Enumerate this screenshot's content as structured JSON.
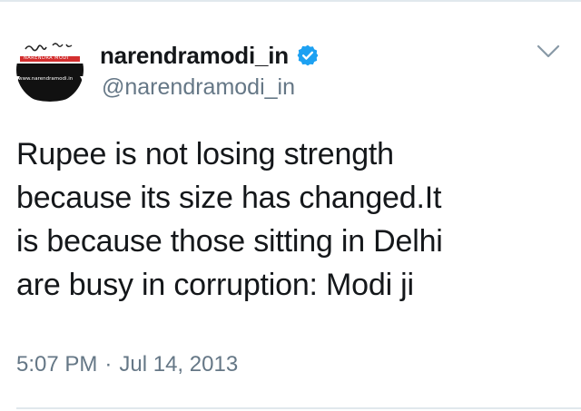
{
  "tweet": {
    "display_name": "narendramodi_in",
    "handle": "@narendramodi_in",
    "verified": true,
    "text": "Rupee is not losing strength\nbecause its size has changed.It\nis because those sitting in Delhi\nare busy in corruption: Modi ji",
    "time": "5:07 PM",
    "separator": "·",
    "date": "Jul 14, 2013"
  },
  "avatar": {
    "signature_text": "नरेन्द्र मोदी",
    "banner_text": "NARENDRA MODI",
    "url_text": "www.narendramodi.in"
  },
  "icons": {
    "verified": "verified-badge-icon",
    "more": "chevron-down-icon"
  },
  "colors": {
    "name": "#14171a",
    "secondary": "#657786",
    "verified_blue": "#1da1f2",
    "divider": "#e1e8ed"
  }
}
